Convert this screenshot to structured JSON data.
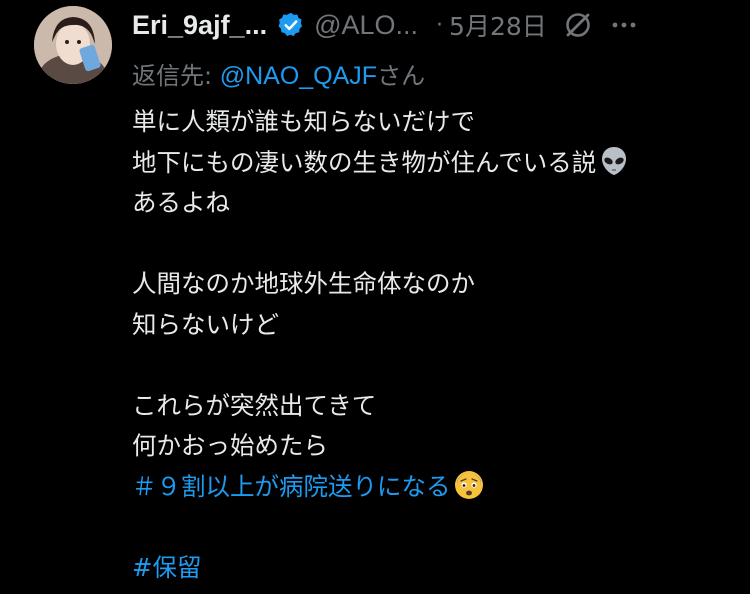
{
  "user": {
    "display_name": "Eri_9ajf_...",
    "handle": "@ALO...",
    "date": "5月28日",
    "separator": "·"
  },
  "reply": {
    "prefix": "返信先: ",
    "mention": "@NAO_QAJF",
    "suffix": "さん"
  },
  "body": {
    "line1": "単に人類が誰も知らないだけで",
    "line2": "地下にもの凄い数の生き物が住んでいる説",
    "line3": "あるよね",
    "line4": "人間なのか地球外生命体なのか",
    "line5": "知らないけど",
    "line6": "これらが突然出てきて",
    "line7": "何かおっ始めたら",
    "hashtag1": "＃９割以上が病院送りになる",
    "hashtag2": "#保留"
  },
  "icons": {
    "verified": "verified-badge-icon",
    "grok": "grok-icon",
    "more": "more-icon",
    "alien": "alien-emoji",
    "anxious": "anxious-face-emoji"
  },
  "colors": {
    "background": "#000000",
    "text": "#e7e9ea",
    "secondary": "#71767b",
    "accent": "#1d9bf0"
  }
}
